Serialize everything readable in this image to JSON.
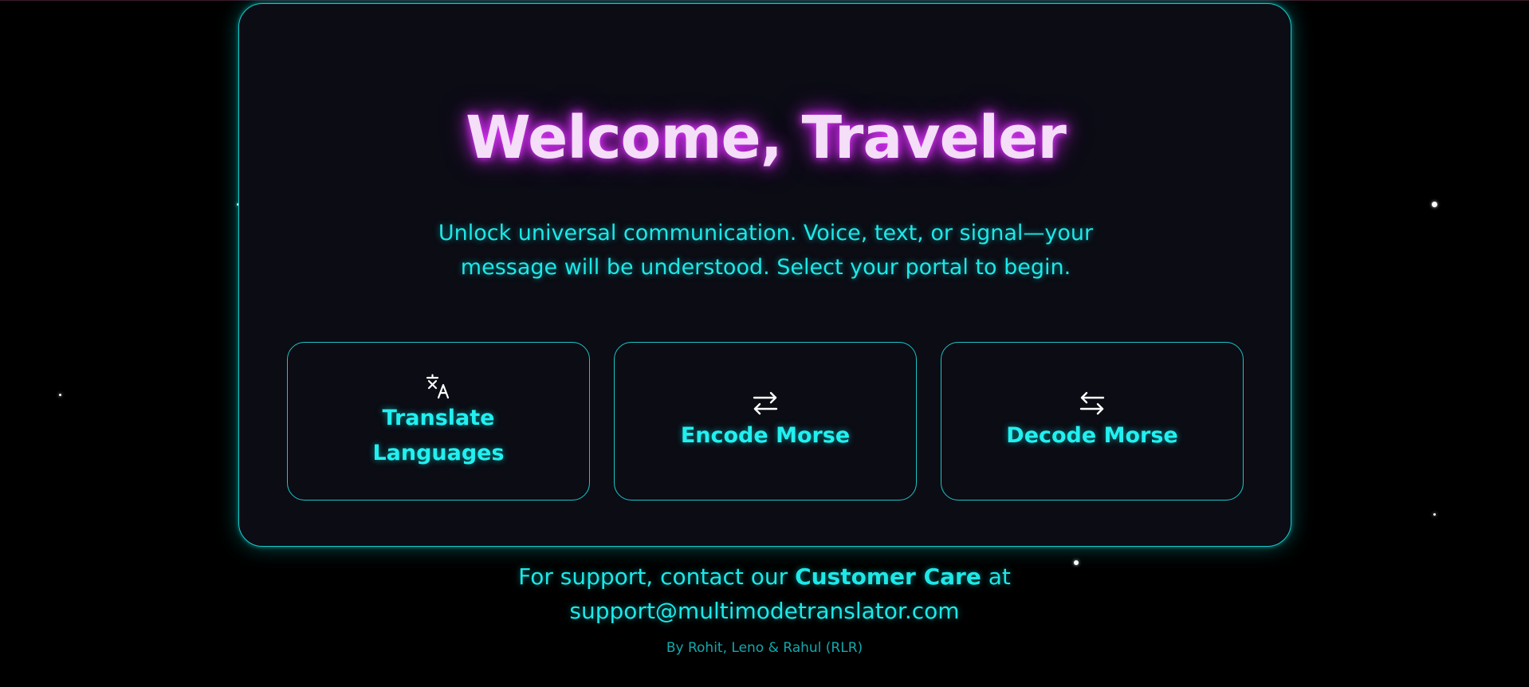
{
  "hero": {
    "title": "Welcome, Traveler",
    "subtitle": "Unlock universal communication. Voice, text, or signal—your message will be understood. Select your portal to begin."
  },
  "portals": [
    {
      "label": "Translate Languages",
      "icon": "translate-icon"
    },
    {
      "label": "Encode Morse",
      "icon": "swap-arrows-icon"
    },
    {
      "label": "Decode Morse",
      "icon": "swap-arrows-icon"
    }
  ],
  "footer": {
    "support_prefix": "For support, contact our",
    "support_highlight": "Customer Care",
    "support_suffix": "at",
    "support_email": "support@multimodetranslator.com",
    "credits": "By Rohit, Leno & Rahul (RLR)"
  },
  "colors": {
    "background": "#000000",
    "panel": "#0b0c14",
    "accent_cyan": "#22f0f0",
    "title_glow": "#e23bff",
    "title_fill": "#f4def8"
  }
}
